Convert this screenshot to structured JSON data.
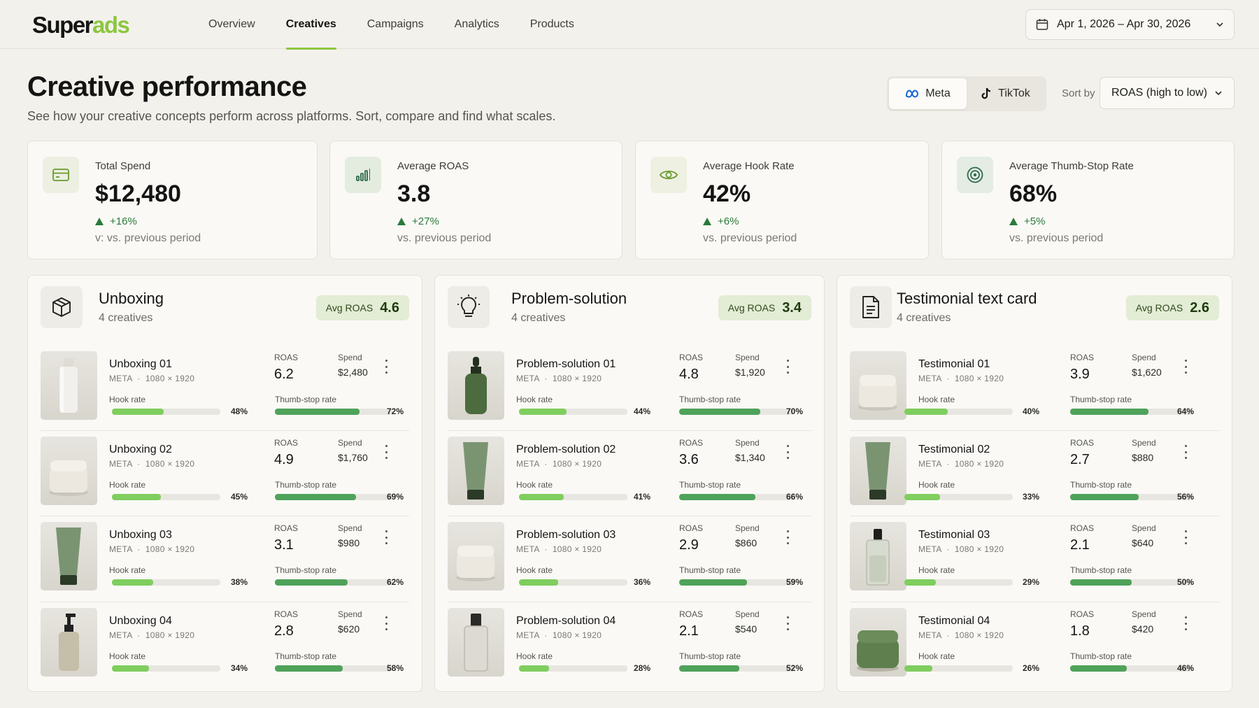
{
  "brand": {
    "name_a": "Super",
    "name_b": "ads"
  },
  "nav": {
    "items": [
      {
        "label": "Overview",
        "active": false
      },
      {
        "label": "Creatives",
        "active": true
      },
      {
        "label": "Campaigns",
        "active": false
      },
      {
        "label": "Analytics",
        "active": false
      },
      {
        "label": "Products",
        "active": false
      }
    ]
  },
  "date_range": "Apr 1, 2026 – Apr 30, 2026",
  "header": {
    "title": "Creative performance",
    "subtitle": "See how your creative concepts perform across platforms. Sort, compare and find what scales."
  },
  "platforms": {
    "meta": "Meta",
    "tiktok": "TikTok",
    "selected": "Meta"
  },
  "sort": {
    "label": "Sort by",
    "value": "ROAS (high to low)"
  },
  "kpis": [
    {
      "label": "Total Spend",
      "value": "$12,480",
      "delta": "+16%",
      "period": "v: vs. previous period",
      "icon": "card-icon"
    },
    {
      "label": "Average ROAS",
      "value": "3.8",
      "delta": "+27%",
      "period": "vs. previous period",
      "icon": "bar-chart-icon"
    },
    {
      "label": "Average Hook Rate",
      "value": "42%",
      "delta": "+6%",
      "period": "vs. previous period",
      "icon": "eye-icon"
    },
    {
      "label": "Average Thumb-Stop Rate",
      "value": "68%",
      "delta": "+5%",
      "period": "vs. previous period",
      "icon": "target-icon"
    }
  ],
  "labels": {
    "avg_roas": "Avg ROAS",
    "roas": "ROAS",
    "spend": "Spend",
    "hook_rate": "Hook rate",
    "thumb_stop_rate": "Thumb-stop rate"
  },
  "colors": {
    "accent": "#8cc63f",
    "hook_bar": "#7fce5e",
    "thumb_bar": "#4fa25a",
    "delta_up": "#2b7a3a"
  },
  "concepts": [
    {
      "title": "Unboxing",
      "count": "4 creatives",
      "avg_roas": "4.6",
      "icon": "box-icon",
      "creatives": [
        {
          "name": "Unboxing 01",
          "platform": "META",
          "size": "1080 × 1920",
          "roas": "6.2",
          "spend": "$2,480",
          "hook": 48,
          "hook_label": "48%",
          "thumb": 72,
          "thumb_label": "72%",
          "product": "white-bottle"
        },
        {
          "name": "Unboxing 02",
          "platform": "META",
          "size": "1080 × 1920",
          "roas": "4.9",
          "spend": "$1,760",
          "hook": 45,
          "hook_label": "45%",
          "thumb": 69,
          "thumb_label": "69%",
          "product": "cream-jar"
        },
        {
          "name": "Unboxing 03",
          "platform": "META",
          "size": "1080 × 1920",
          "roas": "3.1",
          "spend": "$980",
          "hook": 38,
          "hook_label": "38%",
          "thumb": 62,
          "thumb_label": "62%",
          "product": "green-tube"
        },
        {
          "name": "Unboxing 04",
          "platform": "META",
          "size": "1080 × 1920",
          "roas": "2.8",
          "spend": "$620",
          "hook": 34,
          "hook_label": "34%",
          "thumb": 58,
          "thumb_label": "58%",
          "product": "pump-bottle"
        }
      ]
    },
    {
      "title": "Problem-solution",
      "count": "4 creatives",
      "avg_roas": "3.4",
      "icon": "lightbulb-icon",
      "creatives": [
        {
          "name": "Problem-solution 01",
          "platform": "META",
          "size": "1080 × 1920",
          "roas": "4.8",
          "spend": "$1,920",
          "hook": 44,
          "hook_label": "44%",
          "thumb": 70,
          "thumb_label": "70%",
          "product": "dropper-bottle"
        },
        {
          "name": "Problem-solution 02",
          "platform": "META",
          "size": "1080 × 1920",
          "roas": "3.6",
          "spend": "$1,340",
          "hook": 41,
          "hook_label": "41%",
          "thumb": 66,
          "thumb_label": "66%",
          "product": "green-tube"
        },
        {
          "name": "Problem-solution 03",
          "platform": "META",
          "size": "1080 × 1920",
          "roas": "2.9",
          "spend": "$860",
          "hook": 36,
          "hook_label": "36%",
          "thumb": 59,
          "thumb_label": "59%",
          "product": "cream-jar"
        },
        {
          "name": "Problem-solution 04",
          "platform": "META",
          "size": "1080 × 1920",
          "roas": "2.1",
          "spend": "$540",
          "hook": 28,
          "hook_label": "28%",
          "thumb": 52,
          "thumb_label": "52%",
          "product": "clear-bottle"
        }
      ]
    },
    {
      "title": "Testimonial text card",
      "count": "4 creatives",
      "avg_roas": "2.6",
      "icon": "document-icon",
      "creatives": [
        {
          "name": "Testimonial 01",
          "platform": "META",
          "size": "1080 × 1920",
          "roas": "3.9",
          "spend": "$1,620",
          "hook": 40,
          "hook_label": "40%",
          "thumb": 64,
          "thumb_label": "64%",
          "product": "cream-jar"
        },
        {
          "name": "Testimonial 02",
          "platform": "META",
          "size": "1080 × 1920",
          "roas": "2.7",
          "spend": "$880",
          "hook": 33,
          "hook_label": "33%",
          "thumb": 56,
          "thumb_label": "56%",
          "product": "green-tube"
        },
        {
          "name": "Testimonial 03",
          "platform": "META",
          "size": "1080 × 1920",
          "roas": "2.1",
          "spend": "$640",
          "hook": 29,
          "hook_label": "29%",
          "thumb": 50,
          "thumb_label": "50%",
          "product": "perfume-bottle"
        },
        {
          "name": "Testimonial 04",
          "platform": "META",
          "size": "1080 × 1920",
          "roas": "1.8",
          "spend": "$420",
          "hook": 26,
          "hook_label": "26%",
          "thumb": 46,
          "thumb_label": "46%",
          "product": "green-jar"
        }
      ]
    }
  ]
}
